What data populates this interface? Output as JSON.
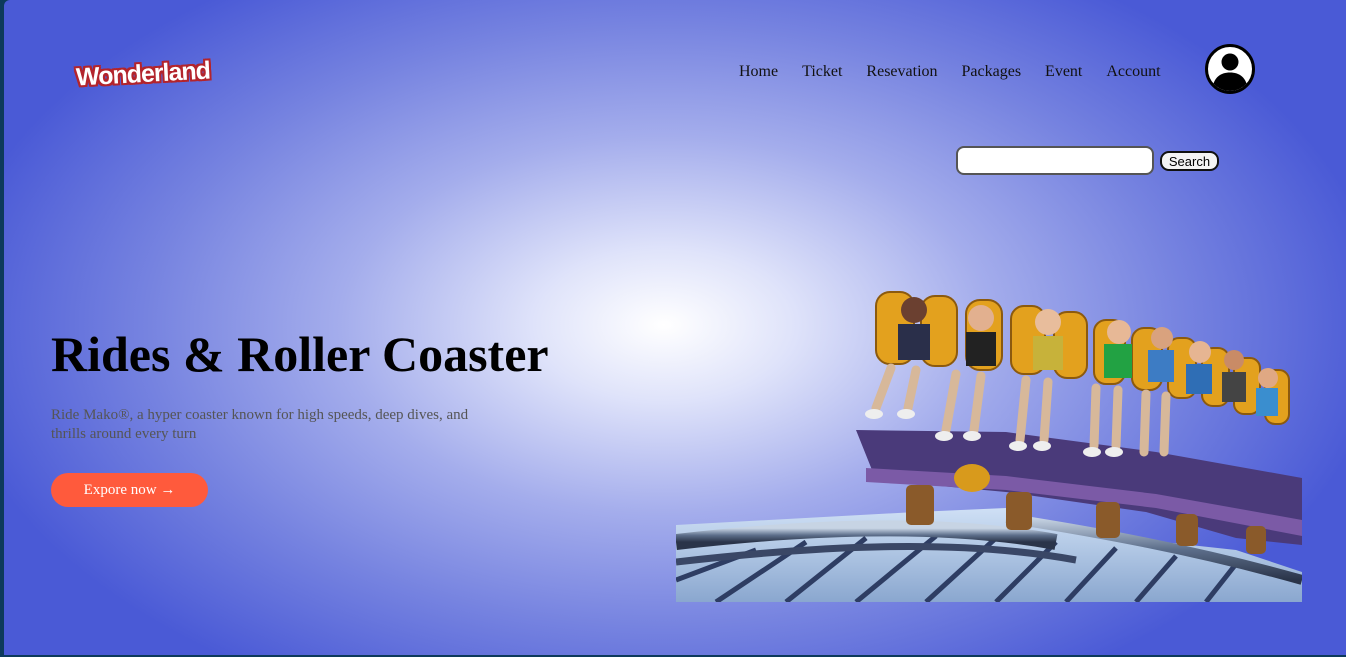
{
  "brand": {
    "logo_text": "Wonderland"
  },
  "nav": {
    "items": [
      {
        "label": "Home"
      },
      {
        "label": "Ticket"
      },
      {
        "label": "Resevation"
      },
      {
        "label": "Packages"
      },
      {
        "label": "Event"
      },
      {
        "label": "Account"
      }
    ],
    "avatar_icon": "user-account-icon"
  },
  "search": {
    "value": "",
    "placeholder": "",
    "button_label": "Search"
  },
  "hero": {
    "title": "Rides & Roller Coaster",
    "description": "Ride Mako®, a hyper coaster known for high speeds, deep dives, and thrills around every turn",
    "cta_label": "Expore now →",
    "image": "roller-coaster-riders-photo"
  },
  "colors": {
    "cta": "#ff5a3c",
    "gradient_center": "#ffffff",
    "gradient_edge": "#4a5ad6",
    "frame": "#0d3a5c"
  }
}
